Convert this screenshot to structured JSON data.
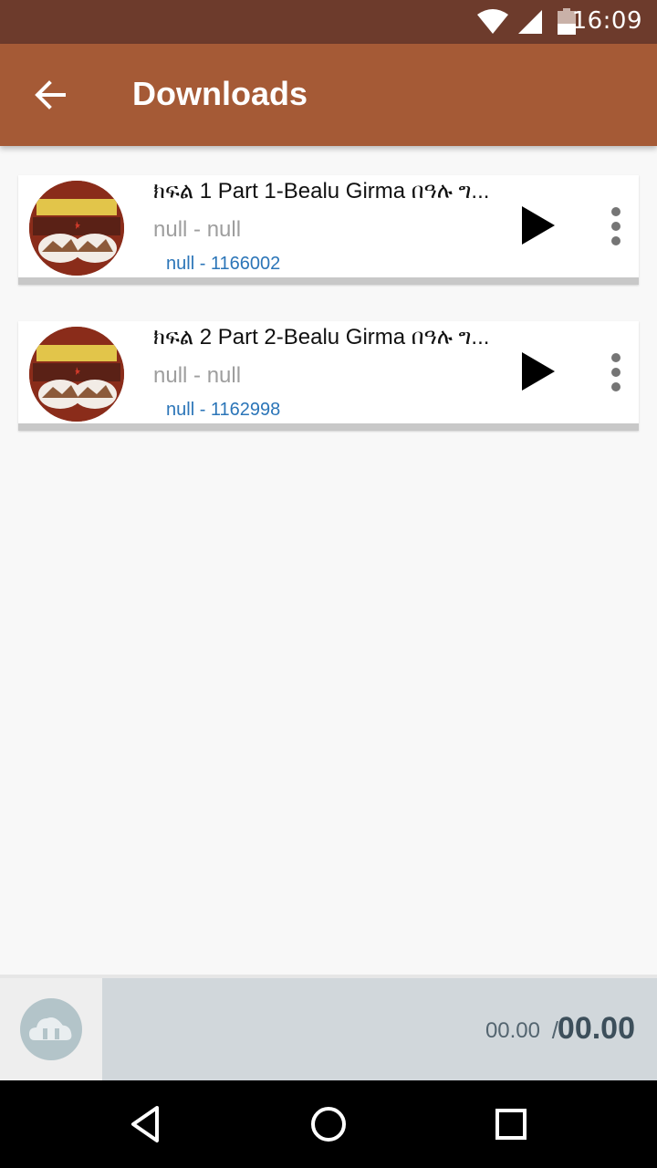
{
  "status_bar": {
    "time": "16:09",
    "icons": [
      "wifi-icon",
      "signal-icon",
      "battery-icon"
    ]
  },
  "app_bar": {
    "title": "Downloads",
    "back_icon": "arrow-left-icon"
  },
  "downloads": [
    {
      "title": "ክፍል 1 Part 1-Bealu Girma በዓሉ ግ...",
      "artist_album": "null - null",
      "meta": "null - 1166002"
    },
    {
      "title": "ክፍል 2 Part 2-Bealu Girma በዓሉ ግ...",
      "artist_album": "null - null",
      "meta": "null - 1162998"
    }
  ],
  "player": {
    "elapsed": "00.00",
    "separator": "/",
    "total": "00.00"
  },
  "colors": {
    "status_bar": "#6d3b2c",
    "app_bar": "#a55a36",
    "meta_text": "#2b75b8",
    "player_bg": "#d1d7db"
  }
}
